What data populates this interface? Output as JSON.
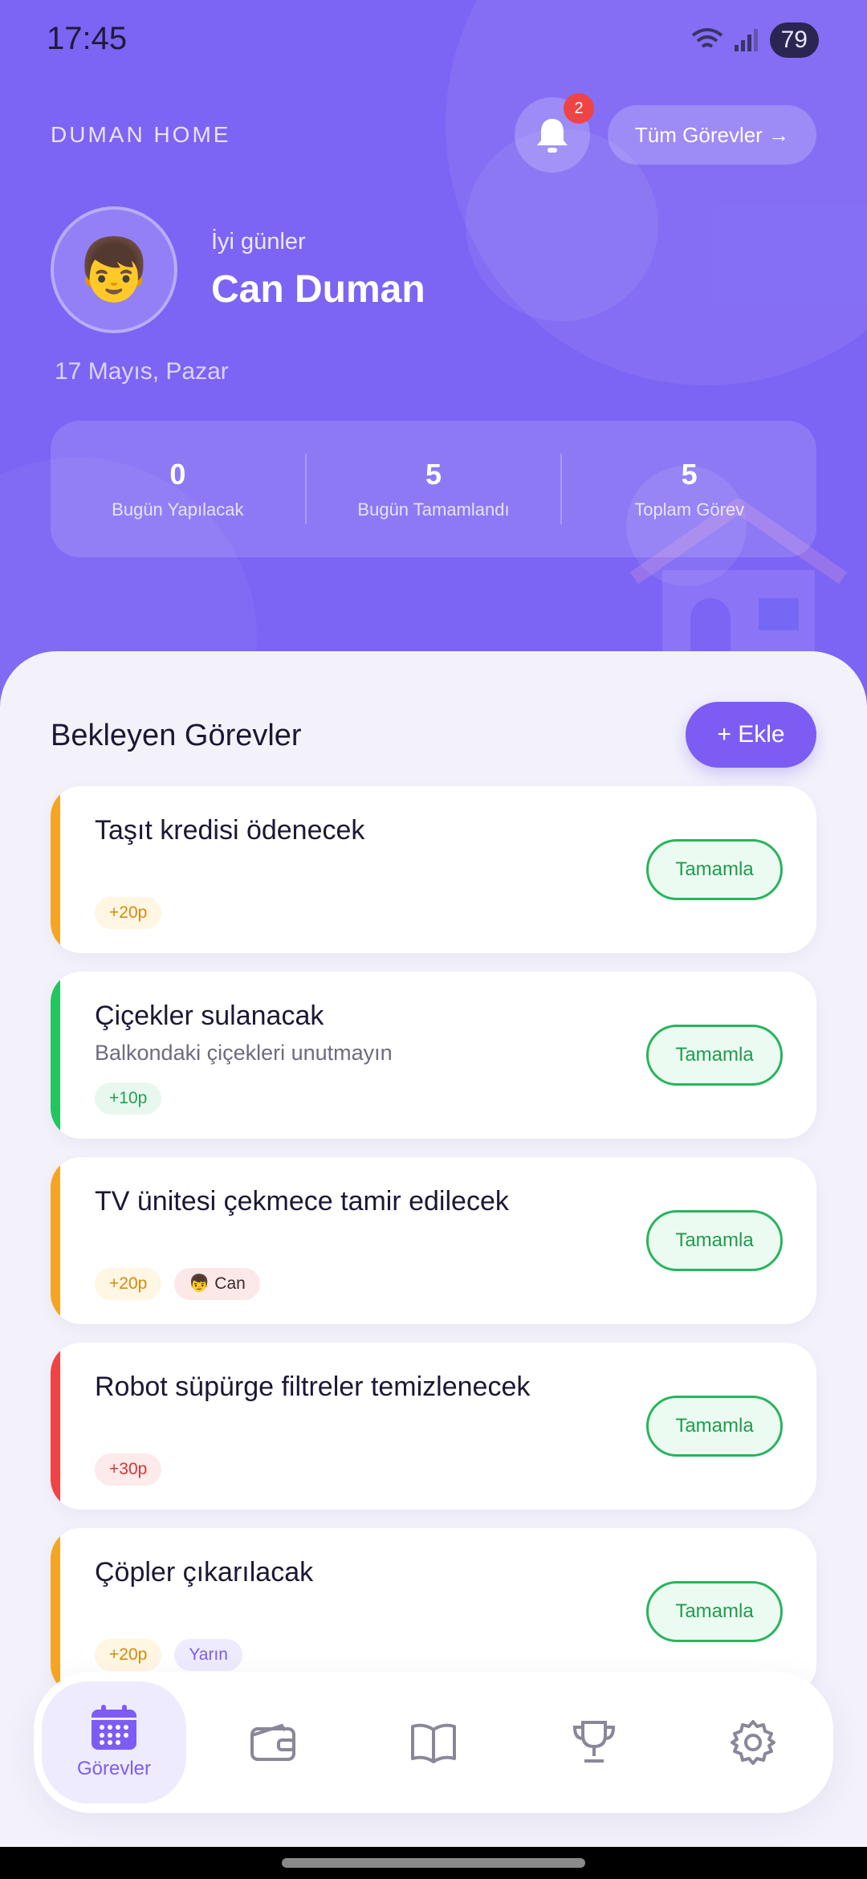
{
  "status_bar": {
    "time": "17:45",
    "battery": "79"
  },
  "header": {
    "brand": "DUMAN HOME",
    "notification_count": "2",
    "all_tasks_label": "Tüm Görevler →",
    "avatar_emoji": "👦",
    "greeting": "İyi günler",
    "user_name": "Can Duman",
    "date": "17 Mayıs, Pazar"
  },
  "stats": [
    {
      "value": "0",
      "label": "Bugün Yapılacak"
    },
    {
      "value": "5",
      "label": "Bugün Tamamlandı"
    },
    {
      "value": "5",
      "label": "Toplam Görev"
    }
  ],
  "section": {
    "title": "Bekleyen Görevler",
    "add_label": "+ Ekle"
  },
  "tasks": [
    {
      "title": "Taşıt kredisi ödenecek",
      "desc": "",
      "points": "+20p",
      "extra": "",
      "button": "Tamamla"
    },
    {
      "title": "Çiçekler sulanacak",
      "desc": "Balkondaki çiçekleri unutmayın",
      "points": "+10p",
      "extra": "",
      "button": "Tamamla"
    },
    {
      "title": "TV ünitesi çekmece tamir edilecek",
      "desc": "",
      "points": "+20p",
      "extra": "👦 Can",
      "button": "Tamamla"
    },
    {
      "title": "Robot süpürge filtreler temizlenecek",
      "desc": "",
      "points": "+30p",
      "extra": "",
      "button": "Tamamla"
    },
    {
      "title": "Çöpler çıkarılacak",
      "desc": "",
      "points": "+20p",
      "extra": "Yarın",
      "button": "Tamamla"
    }
  ],
  "colors": {
    "primary": "#7c64f4",
    "priority_medium": "#f5a524",
    "priority_low": "#22c55e",
    "priority_high": "#ef4444",
    "complete_green": "#27b55d"
  },
  "nav": {
    "active_label": "Görevler",
    "items": [
      "calendar-icon",
      "wallet-icon",
      "book-icon",
      "trophy-icon",
      "settings-icon"
    ]
  }
}
